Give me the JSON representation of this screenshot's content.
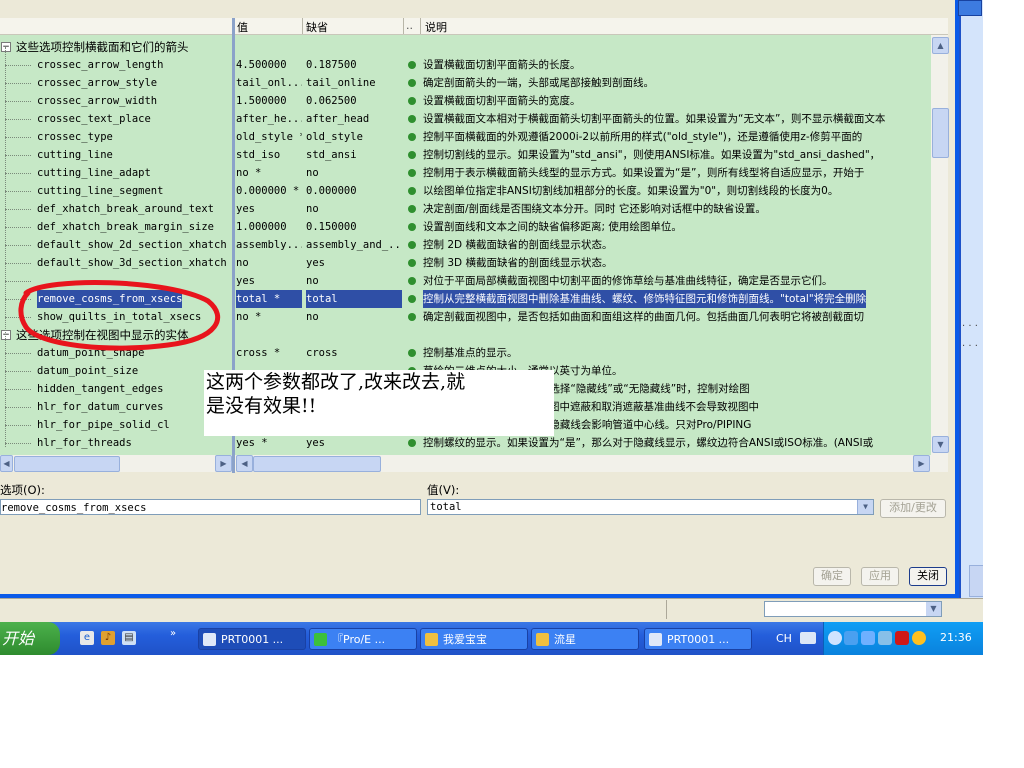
{
  "columns": {
    "name": "",
    "value": "值",
    "default": "缺省",
    "dots": "..",
    "desc": "说明"
  },
  "tree": {
    "groups": [
      {
        "label": "这些选项控制横截面和它们的箭头",
        "toggle": "−"
      },
      {
        "label": "这些选项控制在视图中显示的实体",
        "toggle": "−"
      }
    ],
    "rows": [
      {
        "kind": "group",
        "group": 0
      },
      {
        "kind": "item",
        "name": "crossec_arrow_length",
        "value": "4.500000",
        "default": "0.187500",
        "desc": "设置横截面切割平面箭头的长度。"
      },
      {
        "kind": "item",
        "name": "crossec_arrow_style",
        "value": "tail_onl...",
        "default": "tail_online",
        "desc": "确定剖面箭头的一端，头部或尾部接触到剖面线。"
      },
      {
        "kind": "item",
        "name": "crossec_arrow_width",
        "value": "1.500000",
        "default": "0.062500",
        "desc": "设置横截面切割平面箭头的宽度。"
      },
      {
        "kind": "item",
        "name": "crossec_text_place",
        "value": "after_he...",
        "default": "after_head",
        "desc": "设置横截面文本相对于横截面箭头切割平面箭头的位置。如果设置为“无文本”，则不显示横截面文本"
      },
      {
        "kind": "item",
        "name": "crossec_type",
        "value": "old_style *",
        "default": "old_style",
        "desc": "控制平面横截面的外观遵循2000i-2以前所用的样式(\"old_style\")，还是遵循使用z-修剪平面的"
      },
      {
        "kind": "item",
        "name": "cutting_line",
        "value": "std_iso",
        "default": "std_ansi",
        "desc": "控制切割线的显示。如果设置为\"std_ansi\"，则使用ANSI标准。如果设置为\"std_ansi_dashed\"，"
      },
      {
        "kind": "item",
        "name": "cutting_line_adapt",
        "value": "no *",
        "default": "no",
        "desc": "控制用于表示横截面箭头线型的显示方式。如果设置为“是”，则所有线型将自适应显示，开始于"
      },
      {
        "kind": "item",
        "name": "cutting_line_segment",
        "value": "0.000000 *",
        "default": "0.000000",
        "desc": "以绘图单位指定非ANSI切割线加粗部分的长度。如果设置为\"0\"，则切割线段的长度为0。"
      },
      {
        "kind": "item",
        "name": "def_xhatch_break_around_text",
        "value": "yes",
        "default": "no",
        "desc": "决定剖面/剖面线是否围绕文本分开。同时 它还影响对话框中的缺省设置。"
      },
      {
        "kind": "item",
        "name": "def_xhatch_break_margin_size",
        "value": "1.000000",
        "default": "0.150000",
        "desc": "设置剖面线和文本之间的缺省偏移距离; 使用绘图单位。"
      },
      {
        "kind": "item",
        "name": "default_show_2d_section_xhatch",
        "value": "assembly...",
        "default": "assembly_and_...",
        "desc": "控制 2D 横截面缺省的剖面线显示状态。"
      },
      {
        "kind": "item",
        "name": "default_show_3d_section_xhatch",
        "value": "no",
        "default": "yes",
        "desc": "控制 3D 横截面缺省的剖面线显示状态。"
      },
      {
        "kind": "item",
        "name": "",
        "value": "yes",
        "default": "no",
        "desc": "对位于平面局部横截面视图中切割平面的修饰草绘与基准曲线特征，确定是否显示它们。"
      },
      {
        "kind": "item",
        "name": "remove_cosms_from_xsecs",
        "value": "total *",
        "default": "total",
        "desc": "控制从完整横截面视图中删除基准曲线、螺纹、修饰特征图元和修饰剖面线。\"total\"将完全删除",
        "selected": true
      },
      {
        "kind": "item",
        "name": "show_quilts_in_total_xsecs",
        "value": "no *",
        "default": "no",
        "desc": "确定剖截面视图中，是否包括如曲面和面组这样的曲面几何。包括曲面几何表明它将被剖截面切"
      },
      {
        "kind": "group",
        "group": 1
      },
      {
        "kind": "item",
        "name": "datum_point_shape",
        "value": "cross *",
        "default": "cross",
        "desc": "控制基准点的显示。"
      },
      {
        "kind": "item",
        "name": "datum_point_size",
        "value": "",
        "default": "",
        "desc": "草绘的二维点的大小。通常以英寸为单位。"
      },
      {
        "kind": "item",
        "name": "hidden_tangent_edges",
        "value": "",
        "default": "",
        "desc": "话框中的“显示造型”列表中选择“隐藏线”或“无隐藏线”时，控制对绘图"
      },
      {
        "kind": "item",
        "name": "hlr_for_datum_curves",
        "value": "",
        "default": "",
        "desc": "示时不包括基准曲线。在绘图中遮蔽和取消遮蔽基准曲线不会导致视图中"
      },
      {
        "kind": "item",
        "name": "hlr_for_pipe_solid_cl",
        "value": "",
        "default": "",
        "desc": "如果设置为“是”，那么删除隐藏线会影响管道中心线。只对Pro/PIPING"
      },
      {
        "kind": "item",
        "name": "hlr_for_threads",
        "value": "yes *",
        "default": "yes",
        "desc": "控制螺纹的显示。如果设置为“是”，那么对于隐藏线显示，螺纹边符合ANSI或ISO标准。(ANSI或"
      }
    ]
  },
  "form": {
    "option_label": "选项(O):",
    "option_value": "remove_cosms_from_xsecs",
    "value_label": "值(V):",
    "value_selected": "total",
    "add_change": "添加/更改",
    "ok": "确定",
    "apply": "应用",
    "close": "关闭"
  },
  "annotation": {
    "line1": "这两个参数都改了,改来改去,就",
    "line2": "是没有效果!!"
  },
  "taskbar": {
    "start": "开始",
    "tasks": [
      {
        "label": "PRT0001 ...",
        "icon": "proe-window-icon",
        "active": true
      },
      {
        "label": "『Pro/E ...",
        "icon": "browser-icon",
        "active": false
      },
      {
        "label": "我爱宝宝",
        "icon": "folder-icon",
        "active": false
      },
      {
        "label": "流星",
        "icon": "folder-icon",
        "active": false
      },
      {
        "label": "PRT0001 ...",
        "icon": "proe-window-icon",
        "active": false
      }
    ],
    "lang": "CH",
    "clock": "21:36"
  },
  "colors": {
    "grid_bg": "#c6e8c6",
    "selection": "#2f4fa6",
    "annotation_ellipse": "#e8141c",
    "taskbar": "#245edb",
    "start": "#3a9c3a"
  }
}
